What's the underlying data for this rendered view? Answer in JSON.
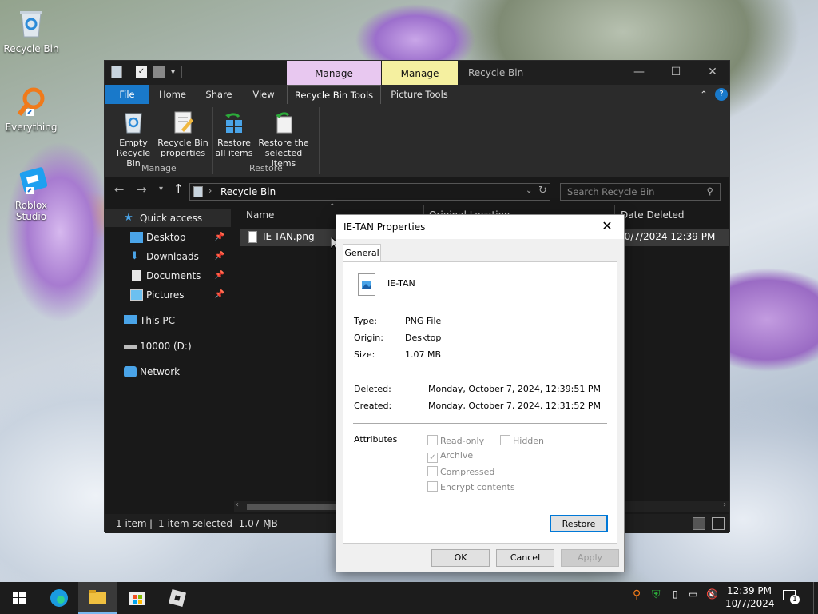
{
  "desktop": {
    "icons": [
      {
        "label": "Recycle Bin"
      },
      {
        "label": "Everything"
      },
      {
        "label": "Roblox Studio"
      }
    ]
  },
  "explorer": {
    "window_title": "Recycle Bin",
    "context_tabs": [
      {
        "label": "Manage",
        "color": "#e8c8f0"
      },
      {
        "label": "Manage",
        "color": "#f5f0a0"
      }
    ],
    "tabs": [
      "File",
      "Home",
      "Share",
      "View",
      "Recycle Bin Tools",
      "Picture Tools"
    ],
    "ribbon": {
      "empty_label_1": "Empty",
      "empty_label_2": "Recycle Bin",
      "props_label_1": "Recycle Bin",
      "props_label_2": "properties",
      "restore_all_1": "Restore",
      "restore_all_2": "all items",
      "restore_sel_1": "Restore the",
      "restore_sel_2": "selected items",
      "group_manage": "Manage",
      "group_restore": "Restore"
    },
    "address": "Recycle Bin",
    "search_placeholder": "Search Recycle Bin",
    "nav": {
      "quick_access": "Quick access",
      "desktop": "Desktop",
      "downloads": "Downloads",
      "documents": "Documents",
      "pictures": "Pictures",
      "this_pc": "This PC",
      "drive": "10000 (D:)",
      "network": "Network"
    },
    "columns": {
      "name": "Name",
      "original_location": "Original Location",
      "date_deleted": "Date Deleted"
    },
    "files": [
      {
        "name": "IE-TAN.png",
        "date_deleted": "10/7/2024 12:39 PM"
      }
    ],
    "status": {
      "count": "1 item",
      "selected": "1 item selected  1.07 MB"
    }
  },
  "properties_dialog": {
    "title": "IE-TAN Properties",
    "tab": "General",
    "file_name": "IE-TAN",
    "type_label": "Type:",
    "type_value": "PNG File",
    "origin_label": "Origin:",
    "origin_value": "Desktop",
    "size_label": "Size:",
    "size_value": "1.07 MB",
    "deleted_label": "Deleted:",
    "deleted_value": "Monday, October 7, 2024, 12:39:51 PM",
    "created_label": "Created:",
    "created_value": "Monday, October 7, 2024, 12:31:52 PM",
    "attributes_label": "Attributes",
    "attr_readonly": "Read-only",
    "attr_hidden": "Hidden",
    "attr_archive": "Archive",
    "attr_compressed": "Compressed",
    "attr_encrypt": "Encrypt contents",
    "restore_button": "Restore",
    "ok_button": "OK",
    "cancel_button": "Cancel",
    "apply_button": "Apply"
  },
  "taskbar": {
    "time": "12:39 PM",
    "date": "10/7/2024",
    "notification_count": "1"
  }
}
